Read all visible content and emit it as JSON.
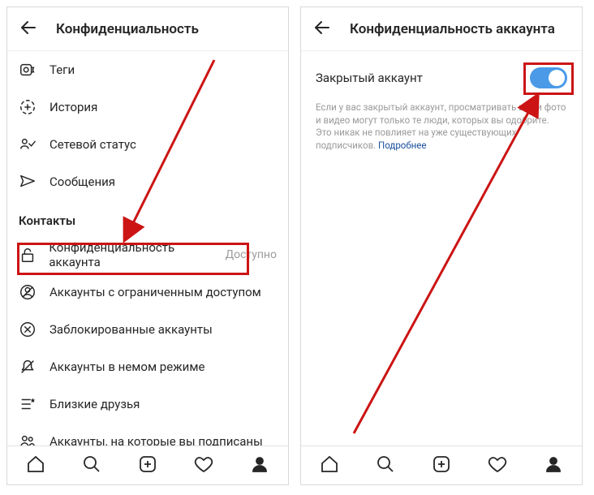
{
  "left": {
    "header": {
      "title": "Конфиденциальность"
    },
    "items": [
      {
        "label": "Теги"
      },
      {
        "label": "История"
      },
      {
        "label": "Сетевой статус"
      },
      {
        "label": "Сообщения"
      }
    ],
    "section_title": "Контакты",
    "contacts": [
      {
        "label": "Конфиденциальность аккаунта",
        "suffix": "Доступно"
      },
      {
        "label": "Аккаунты с ограниченным доступом"
      },
      {
        "label": "Заблокированные аккаунты"
      },
      {
        "label": "Аккаунты в немом режиме"
      },
      {
        "label": "Близкие друзья"
      },
      {
        "label": "Аккаунты, на которые вы подписаны"
      }
    ]
  },
  "right": {
    "header": {
      "title": "Конфиденциальность аккаунта"
    },
    "toggle_label": "Закрытый аккаунт",
    "help_text": "Если у вас закрытый аккаунт, просматривать ваши фото и видео могут только те люди, которых вы одобрите. Это никак не повлияет на уже существующих подписчиков.",
    "more_label": "Подробнее"
  }
}
